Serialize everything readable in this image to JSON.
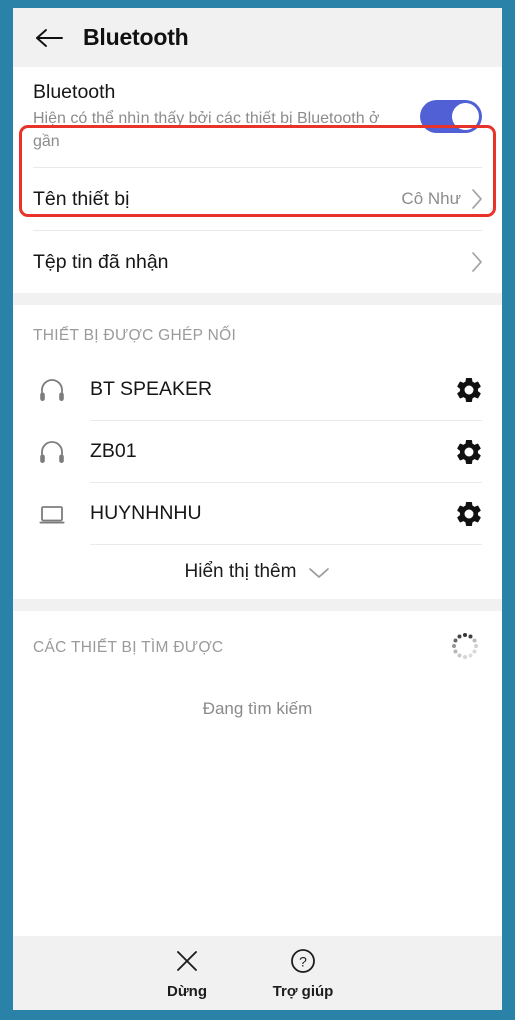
{
  "appbar": {
    "back_icon": "arrow-left-icon",
    "title": "Bluetooth"
  },
  "bluetooth_switch": {
    "title": "Bluetooth",
    "subtitle": "Hiện có thể nhìn thấy bởi các thiết bị Bluetooth ở gần",
    "enabled": true,
    "accent_color": "#5260d6",
    "highlight_color": "#e8332a"
  },
  "settings_rows": [
    {
      "label": "Tên thiết bị",
      "value": "Cô Như",
      "chevron": "chevron-right-icon"
    },
    {
      "label": "Tệp tin đã nhận",
      "value": "",
      "chevron": "chevron-right-icon"
    }
  ],
  "paired_section": {
    "title": "THIẾT BỊ ĐƯỢC GHÉP NỐI",
    "devices": [
      {
        "name": "BT SPEAKER",
        "icon": "headphones-icon",
        "action_icon": "gear-icon"
      },
      {
        "name": "ZB01",
        "icon": "headphones-icon",
        "action_icon": "gear-icon"
      },
      {
        "name": "HUYNHNHU",
        "icon": "laptop-icon",
        "action_icon": "gear-icon"
      }
    ],
    "show_more_label": "Hiển thị thêm",
    "show_more_icon": "chevron-down-icon"
  },
  "available_section": {
    "title": "CÁC THIẾT BỊ TÌM ĐƯỢC",
    "spinner_icon": "loading-spinner-icon",
    "status_text": "Đang tìm kiếm"
  },
  "bottom_bar": {
    "buttons": [
      {
        "label": "Dừng",
        "icon": "close-x-icon"
      },
      {
        "label": "Trợ giúp",
        "icon": "question-circle-icon"
      }
    ]
  },
  "frame": {
    "color": "#2b82a8"
  }
}
